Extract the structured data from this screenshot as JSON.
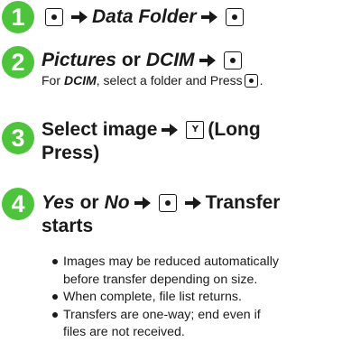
{
  "colors": {
    "step_badge": "#4ec43d",
    "text": "#1a1a1a"
  },
  "icons": {
    "center_key": "center-select-key-icon",
    "arrow": "right-arrow-icon",
    "softkey": "y-softkey-icon"
  },
  "steps": [
    {
      "number": "1",
      "text": "Data Folder"
    },
    {
      "number": "2",
      "opt_a": "Pictures",
      "or": "or",
      "opt_b": "DCIM",
      "note_pre": "For",
      "note_em": "DCIM",
      "note_post": ", select a folder and Press",
      "note_end": "."
    },
    {
      "number": "3",
      "line1": "Select image",
      "line2": "(Long",
      "line3": "Press)"
    },
    {
      "number": "4",
      "opt_a": "Yes",
      "or": "or",
      "opt_b": "No",
      "line_tail": "Transfer",
      "line2": "starts"
    }
  ],
  "softkey_glyph": "Y",
  "bullets": [
    {
      "line1": "Images may be reduced automatically",
      "line2": "before transfer depending on size."
    },
    {
      "line1": "When complete, file list returns.",
      "line2": ""
    },
    {
      "line1": "Transfers are one-way; end even if",
      "line2": "files are not received."
    }
  ]
}
